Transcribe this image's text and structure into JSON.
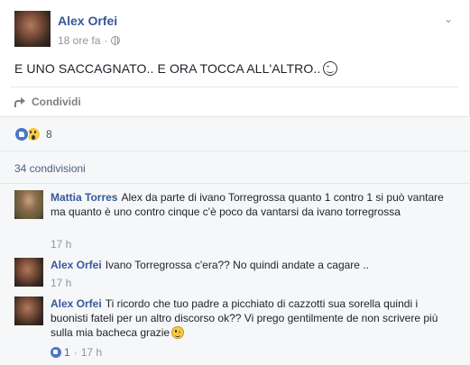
{
  "post": {
    "author": "Alex Orfei",
    "time": "18 ore fa",
    "separator": "·",
    "text": "E UNO SACCAGNATO.. E ORA TOCCA ALL'ALTRO..",
    "share_label": "Condividi"
  },
  "reactions": {
    "count": "8",
    "types": [
      "like",
      "wow"
    ]
  },
  "shares": {
    "label": "34 condivisioni"
  },
  "comments": [
    {
      "author": "Mattia Torres",
      "text": "Alex da parte di ivano Torregrossa quanto 1 contro 1 si può vantare ma quanto è uno contro cinque c'è poco da vantarsi da ivano torregrossa",
      "time": "17 h"
    },
    {
      "author": "Alex Orfei",
      "text": "Ivano Torregrossa c'era?? No quindi andate a cagare ..",
      "time": "17 h"
    },
    {
      "author": "Alex Orfei",
      "text": "Ti ricordo che tuo padre a picchiato di cazzotti sua sorella quindi i buonisti fateli per un altro discorso ok?? Vi prego gentilmente de non scrivere più sulla mia bacheca grazie",
      "likes": "1",
      "separator": "·",
      "time": "17 h"
    }
  ],
  "icons": {
    "privacy": "globe-icon",
    "menu": "chevron-down-icon",
    "share": "share-icon",
    "post_emoji": "grin-emoji-icon",
    "comment_emoji": "wink-emoji-icon"
  }
}
